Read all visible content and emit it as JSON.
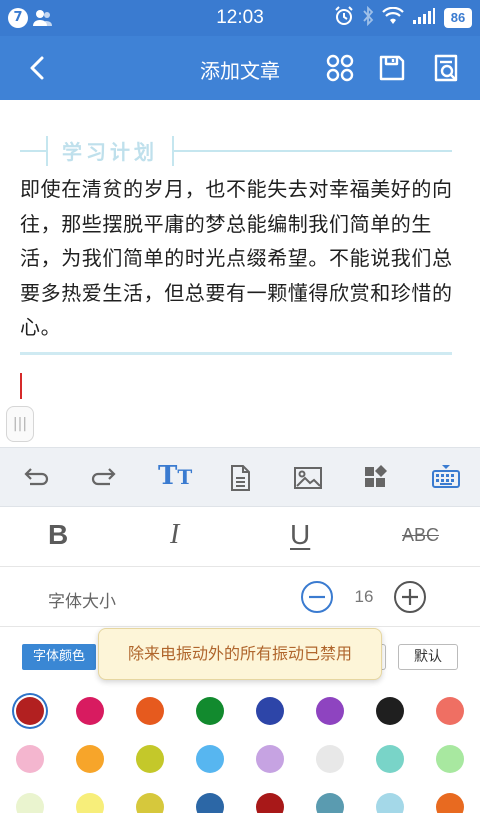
{
  "status_bar": {
    "notification_count": "7",
    "time": "12:03",
    "battery": "86"
  },
  "title_bar": {
    "title": "添加文章"
  },
  "editor": {
    "heading": "学习计划",
    "body": "即使在清贫的岁月，也不能失去对幸福美好的向往，那些摆脱平庸的梦总能编制我们简单的生活，为我们简单的时光点缀希望。不能说我们总要多热爱生活，但总要有一颗懂得欣赏和珍惜的心。"
  },
  "toolbar": {
    "text_format_label": "T",
    "text_format_label_small": "T",
    "active_accent": "#3a7bd0"
  },
  "style_row": {
    "bold": "B",
    "italic": "I",
    "underline": "U",
    "strikethrough": "ABC"
  },
  "font_size": {
    "label": "字体大小",
    "value": "16"
  },
  "color_panel": {
    "tab_label": "字体颜色",
    "default_label": "默认",
    "swatches": [
      "#b22020",
      "#d81b60",
      "#e65a1e",
      "#128a2e",
      "#2d45a8",
      "#8e44c0",
      "#1f1f1f",
      "#ef6f63",
      "#f4b6cf",
      "#f7a52a",
      "#c4c82a",
      "#57b6f0",
      "#c6a3e2",
      "#e8e8e8",
      "#79d4c8",
      "#a8e8a0",
      "#eaf4cf",
      "#f7ee7a",
      "#d6c83c",
      "#2c67a6",
      "#a81818",
      "#5a9bb0",
      "#a4d8e8",
      "#e86a20"
    ],
    "selected_index": 0
  },
  "toast": {
    "message": "除来电振动外的所有振动已禁用"
  }
}
